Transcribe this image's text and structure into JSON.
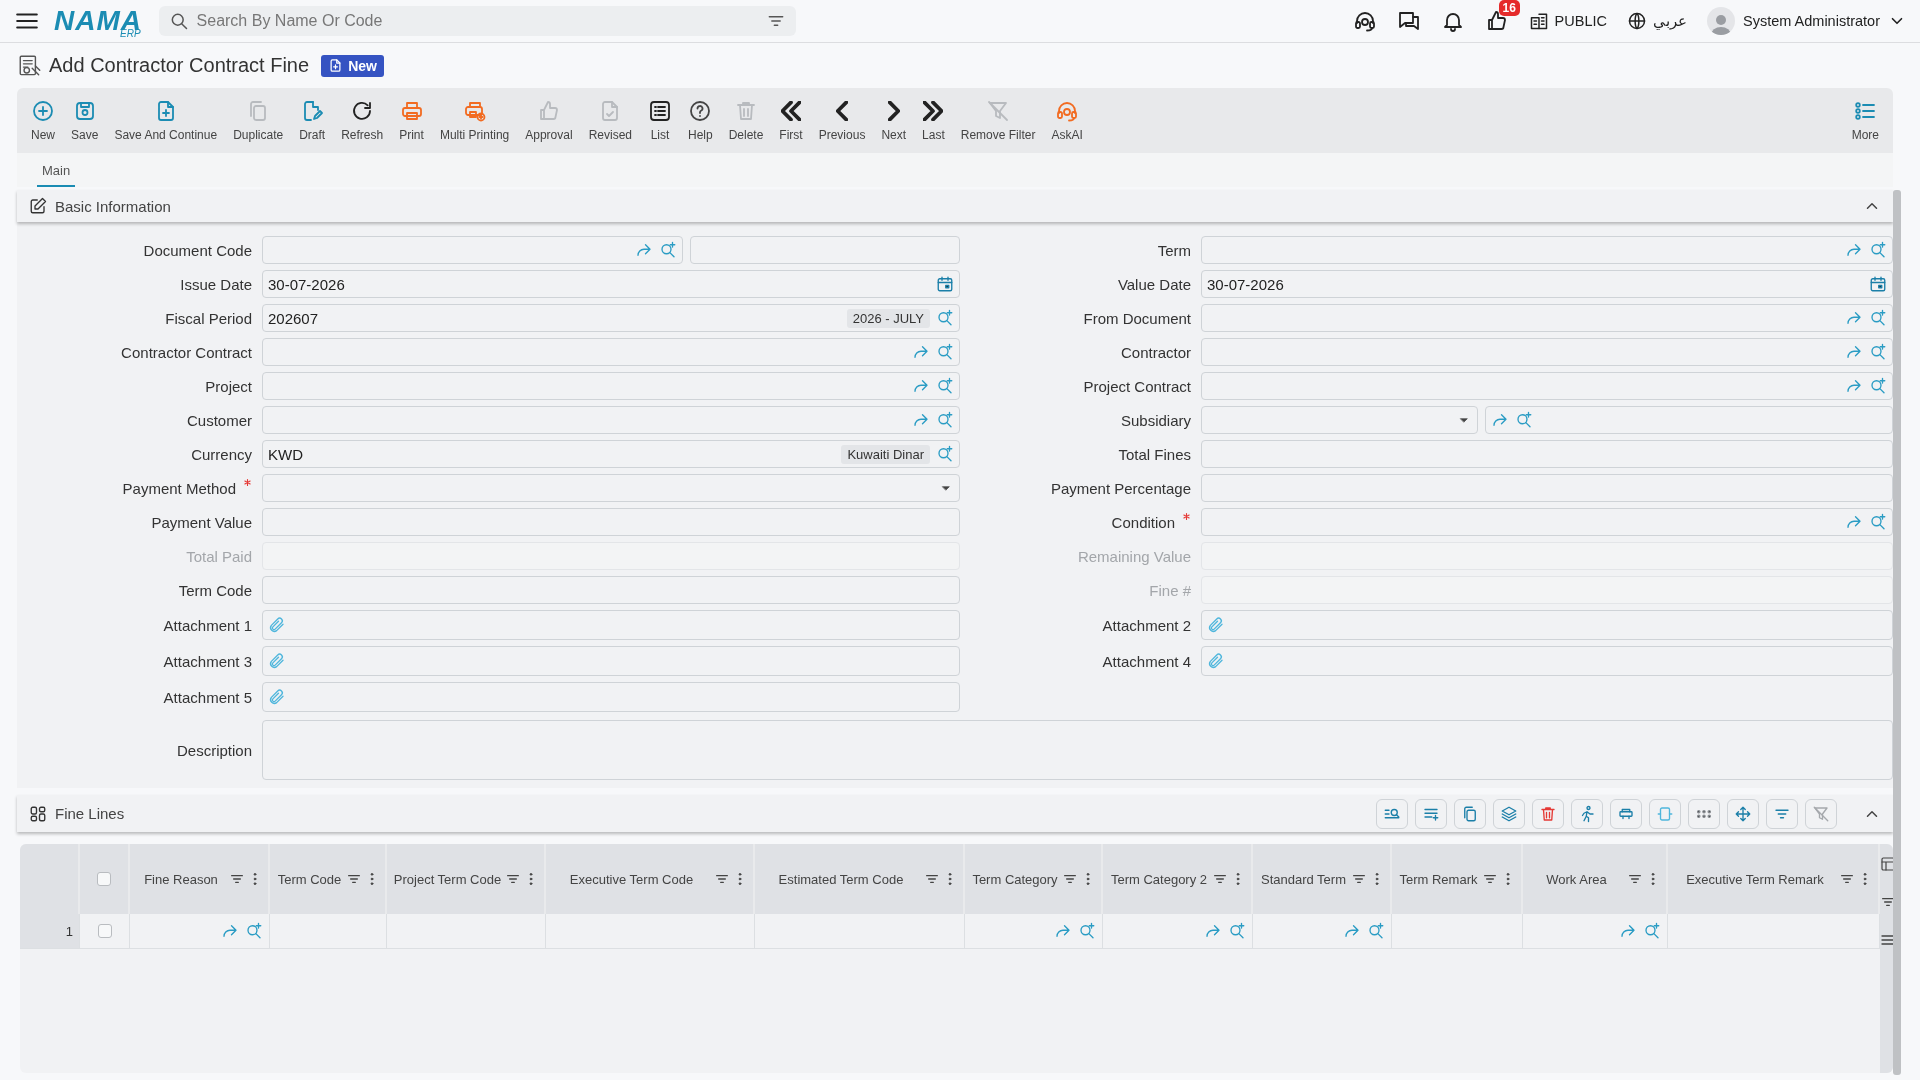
{
  "top_bar": {
    "logo": {
      "name": "NAMA",
      "suffix": "ERP"
    },
    "search": {
      "placeholder": "Search By Name Or Code"
    },
    "notifications_badge": "16",
    "company": "PUBLIC",
    "language": "عربي",
    "user": "System Administrator"
  },
  "page": {
    "title": "Add Contractor Contract Fine",
    "mode_badge": "New"
  },
  "toolbar": {
    "buttons": [
      {
        "label": "New",
        "color": "#1b8cb3"
      },
      {
        "label": "Save",
        "color": "#1b8cb3"
      },
      {
        "label": "Save And Continue",
        "color": "#1b8cb3"
      },
      {
        "label": "Duplicate",
        "color": "#b8bbbf"
      },
      {
        "label": "Draft",
        "color": "#1b8cb3"
      },
      {
        "label": "Refresh",
        "color": "#222222"
      },
      {
        "label": "Print",
        "color": "#f26b21"
      },
      {
        "label": "Multi Printing",
        "color": "#f26b21"
      },
      {
        "label": "Approval",
        "color": "#b8bbbf"
      },
      {
        "label": "Revised",
        "color": "#b8bbbf"
      },
      {
        "label": "List",
        "color": "#222222"
      },
      {
        "label": "Help",
        "color": "#444444"
      },
      {
        "label": "Delete",
        "color": "#b8bbbf"
      },
      {
        "label": "First",
        "color": "#222222"
      },
      {
        "label": "Previous",
        "color": "#222222"
      },
      {
        "label": "Next",
        "color": "#222222"
      },
      {
        "label": "Last",
        "color": "#222222"
      },
      {
        "label": "Remove Filter",
        "color": "#b8bbbf"
      },
      {
        "label": "AskAI",
        "color": "#f26b21"
      }
    ],
    "more": "More"
  },
  "tabs": [
    {
      "label": "Main",
      "selected": true
    }
  ],
  "basic_information": {
    "title": "Basic Information",
    "expanded": true,
    "left_fields": [
      {
        "label": "Document Code",
        "kind": "lookup-pair",
        "required": false,
        "disabled": false
      },
      {
        "label": "Issue Date",
        "kind": "date",
        "value": "30-07-2026",
        "required": false,
        "disabled": false
      },
      {
        "label": "Fiscal Period",
        "kind": "coded",
        "value": "202607",
        "tag": "2026 - JULY",
        "required": false,
        "disabled": false
      },
      {
        "label": "Contractor Contract",
        "kind": "lookup",
        "required": false,
        "disabled": false
      },
      {
        "label": "Project",
        "kind": "lookup",
        "required": false,
        "disabled": false
      },
      {
        "label": "Customer",
        "kind": "lookup",
        "required": false,
        "disabled": false
      },
      {
        "label": "Currency",
        "kind": "coded",
        "value": "KWD",
        "tag": "Kuwaiti Dinar",
        "required": false,
        "disabled": false
      },
      {
        "label": "Payment Method",
        "kind": "select",
        "required": true,
        "disabled": false
      },
      {
        "label": "Payment Value",
        "kind": "text",
        "required": false,
        "disabled": false
      },
      {
        "label": "Total Paid",
        "kind": "text",
        "required": false,
        "disabled": true
      },
      {
        "label": "Term Code",
        "kind": "text",
        "required": false,
        "disabled": false
      },
      {
        "label": "Attachment 1",
        "kind": "attachment",
        "required": false,
        "disabled": false
      },
      {
        "label": "Attachment 3",
        "kind": "attachment",
        "required": false,
        "disabled": false
      },
      {
        "label": "Attachment 5",
        "kind": "attachment",
        "required": false,
        "disabled": false
      }
    ],
    "right_fields": [
      {
        "label": "Term",
        "kind": "lookup",
        "required": false,
        "disabled": false
      },
      {
        "label": "Value Date",
        "kind": "date",
        "value": "30-07-2026",
        "required": false,
        "disabled": false
      },
      {
        "label": "From Document",
        "kind": "lookup",
        "required": false,
        "disabled": false
      },
      {
        "label": "Contractor",
        "kind": "lookup",
        "required": false,
        "disabled": false
      },
      {
        "label": "Project Contract",
        "kind": "lookup",
        "required": false,
        "disabled": false
      },
      {
        "label": "Subsidiary",
        "kind": "select-lookup",
        "required": false,
        "disabled": false
      },
      {
        "label": "Total Fines",
        "kind": "text",
        "required": false,
        "disabled": false
      },
      {
        "label": "Payment Percentage",
        "kind": "text",
        "required": false,
        "disabled": false
      },
      {
        "label": "Condition",
        "kind": "lookup",
        "required": true,
        "disabled": false
      },
      {
        "label": "Remaining Value",
        "kind": "text",
        "required": false,
        "disabled": true
      },
      {
        "label": "Fine #",
        "kind": "text",
        "required": false,
        "disabled": true
      },
      {
        "label": "Attachment 2",
        "kind": "attachment",
        "required": false,
        "disabled": false
      },
      {
        "label": "Attachment 4",
        "kind": "attachment",
        "required": false,
        "disabled": false
      }
    ],
    "description": {
      "label": "Description"
    }
  },
  "fine_lines": {
    "title": "Fine Lines",
    "expanded": true,
    "all_selected": false,
    "columns": [
      {
        "label": "Fine Reason"
      },
      {
        "label": "Term Code"
      },
      {
        "label": "Project Term Code"
      },
      {
        "label": "Executive Term Code"
      },
      {
        "label": "Estimated Term Code"
      },
      {
        "label": "Term Category"
      },
      {
        "label": "Term Category 2"
      },
      {
        "label": "Standard Term"
      },
      {
        "label": "Term Remark"
      },
      {
        "label": "Work Area"
      },
      {
        "label": "Executive Term Remark"
      }
    ],
    "rows": [
      {
        "number": "1",
        "selected": false,
        "cells": [
          {
            "kind": "lookup"
          },
          {
            "kind": "empty"
          },
          {
            "kind": "empty"
          },
          {
            "kind": "empty"
          },
          {
            "kind": "empty"
          },
          {
            "kind": "lookup"
          },
          {
            "kind": "lookup"
          },
          {
            "kind": "lookup"
          },
          {
            "kind": "empty"
          },
          {
            "kind": "lookup"
          },
          {
            "kind": "empty"
          }
        ]
      }
    ]
  }
}
